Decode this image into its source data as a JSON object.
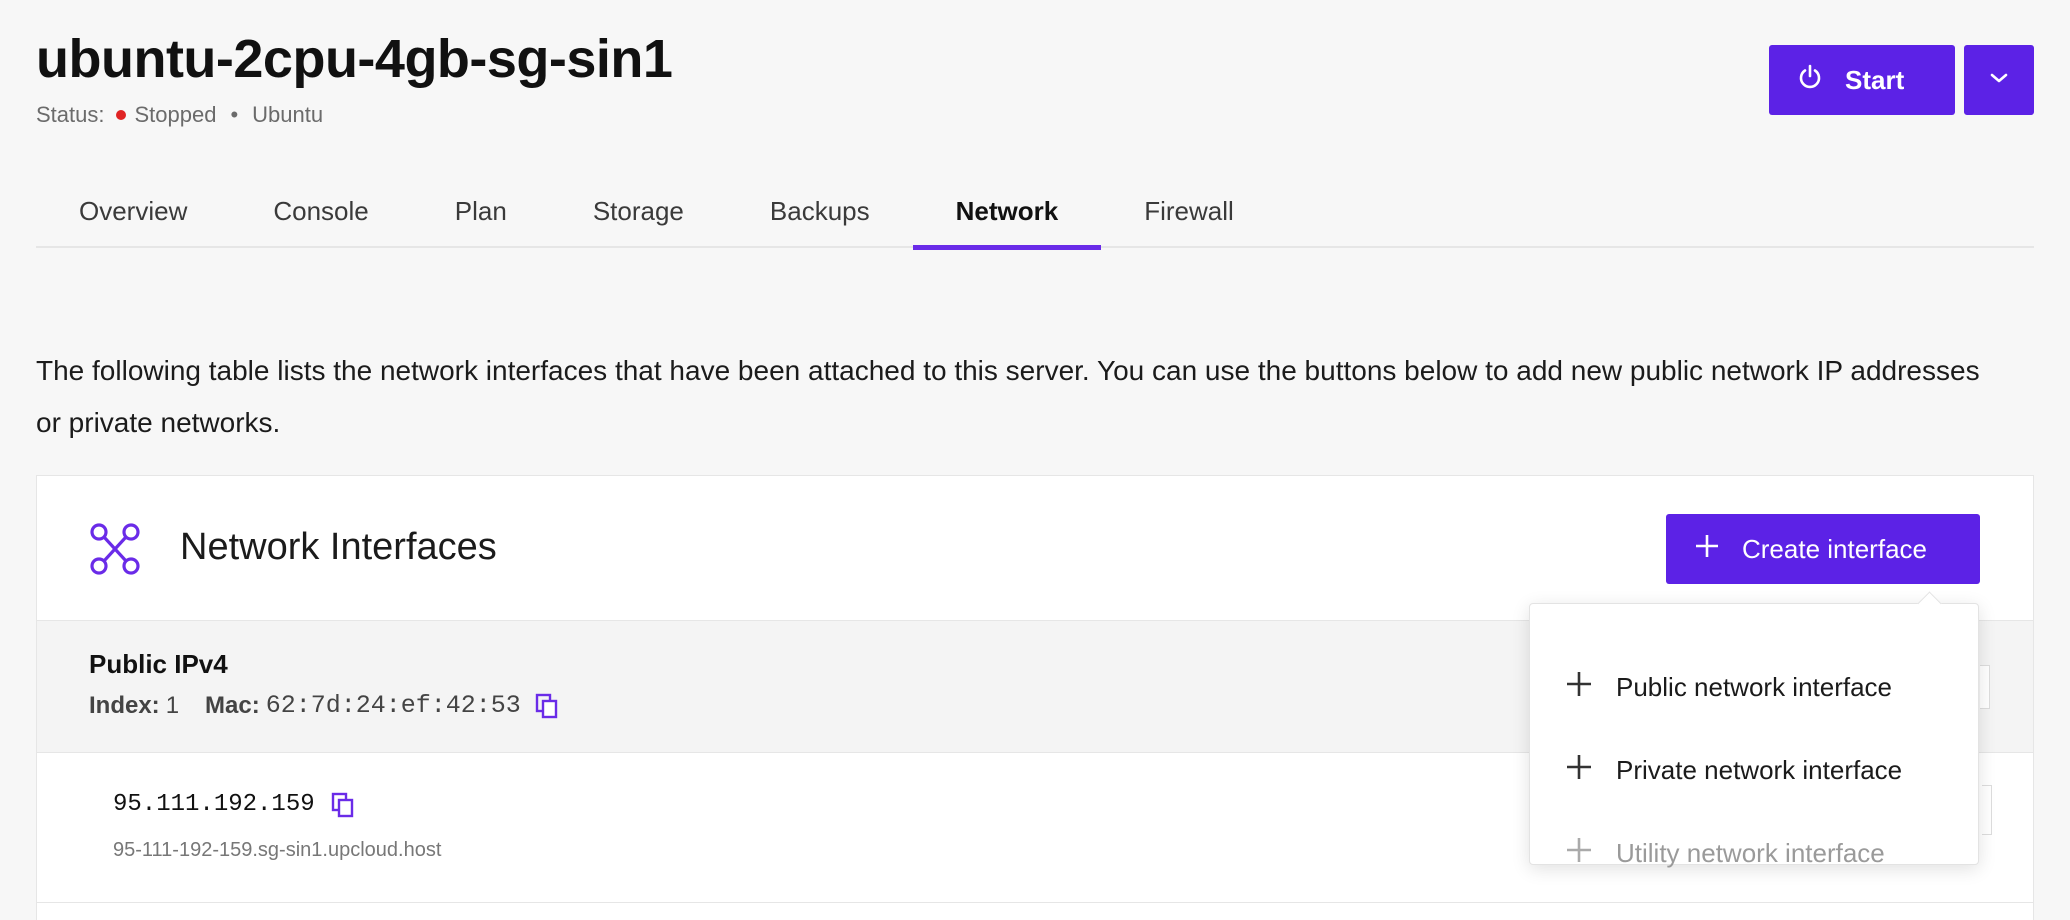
{
  "server": {
    "title": "ubuntu-2cpu-4gb-sg-sin1",
    "status_label": "Status:",
    "status_value": "Stopped",
    "os": "Ubuntu",
    "status_color": "#e02424"
  },
  "actions": {
    "start_label": "Start"
  },
  "tabs": [
    {
      "label": "Overview"
    },
    {
      "label": "Console"
    },
    {
      "label": "Plan"
    },
    {
      "label": "Storage"
    },
    {
      "label": "Backups"
    },
    {
      "label": "Network",
      "active": true
    },
    {
      "label": "Firewall"
    }
  ],
  "description": "The following table lists the network interfaces that have been attached to this server. You can use the buttons below to add new public network IP addresses or private networks.",
  "panel": {
    "title": "Network Interfaces",
    "create_label": "Create interface"
  },
  "interface": {
    "type": "Public IPv4",
    "index_label": "Index:",
    "index_value": "1",
    "mac_label": "Mac:",
    "mac_value": "62:7d:24:ef:42:53"
  },
  "ip": {
    "address": "95.111.192.159",
    "hostname": "95-111-192-159.sg-sin1.upcloud.host"
  },
  "dropdown": {
    "items": [
      {
        "label": "Public network interface",
        "disabled": false
      },
      {
        "label": "Private network interface",
        "disabled": false
      },
      {
        "label": "Utility network interface",
        "disabled": true
      }
    ]
  },
  "colors": {
    "accent": "#5c22e6",
    "background": "#f7f7f7"
  },
  "icons": {
    "start": "power-icon",
    "more": "chevron-down-icon",
    "panel": "network-nodes-icon",
    "create": "plus-icon",
    "copy": "copy-icon"
  }
}
